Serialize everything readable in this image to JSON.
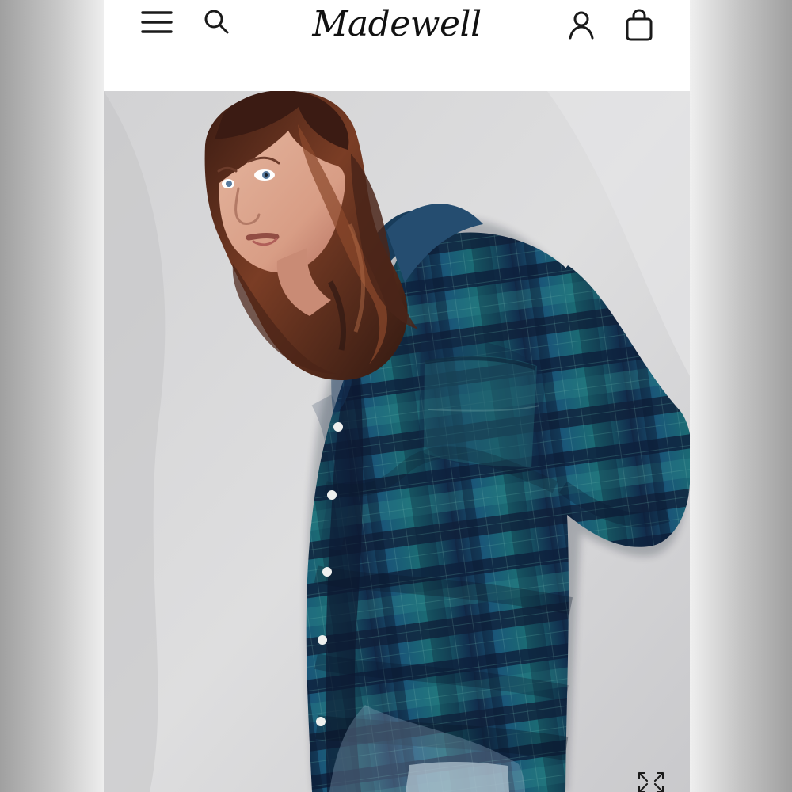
{
  "brand": {
    "logo_text": "Madewell"
  },
  "header": {
    "menu_icon": "hamburger-menu-icon",
    "search_icon": "search-icon",
    "account_icon": "account-icon",
    "bag_icon": "shopping-bag-icon"
  },
  "gallery": {
    "expand_icon": "expand-icon"
  },
  "colors": {
    "page_background": "#ffffff",
    "text": "#111111",
    "photo_background": "#d6d6d8",
    "plaid_dark": "#10213d",
    "plaid_teal": "#1f6b73",
    "plaid_blue": "#174b72"
  }
}
